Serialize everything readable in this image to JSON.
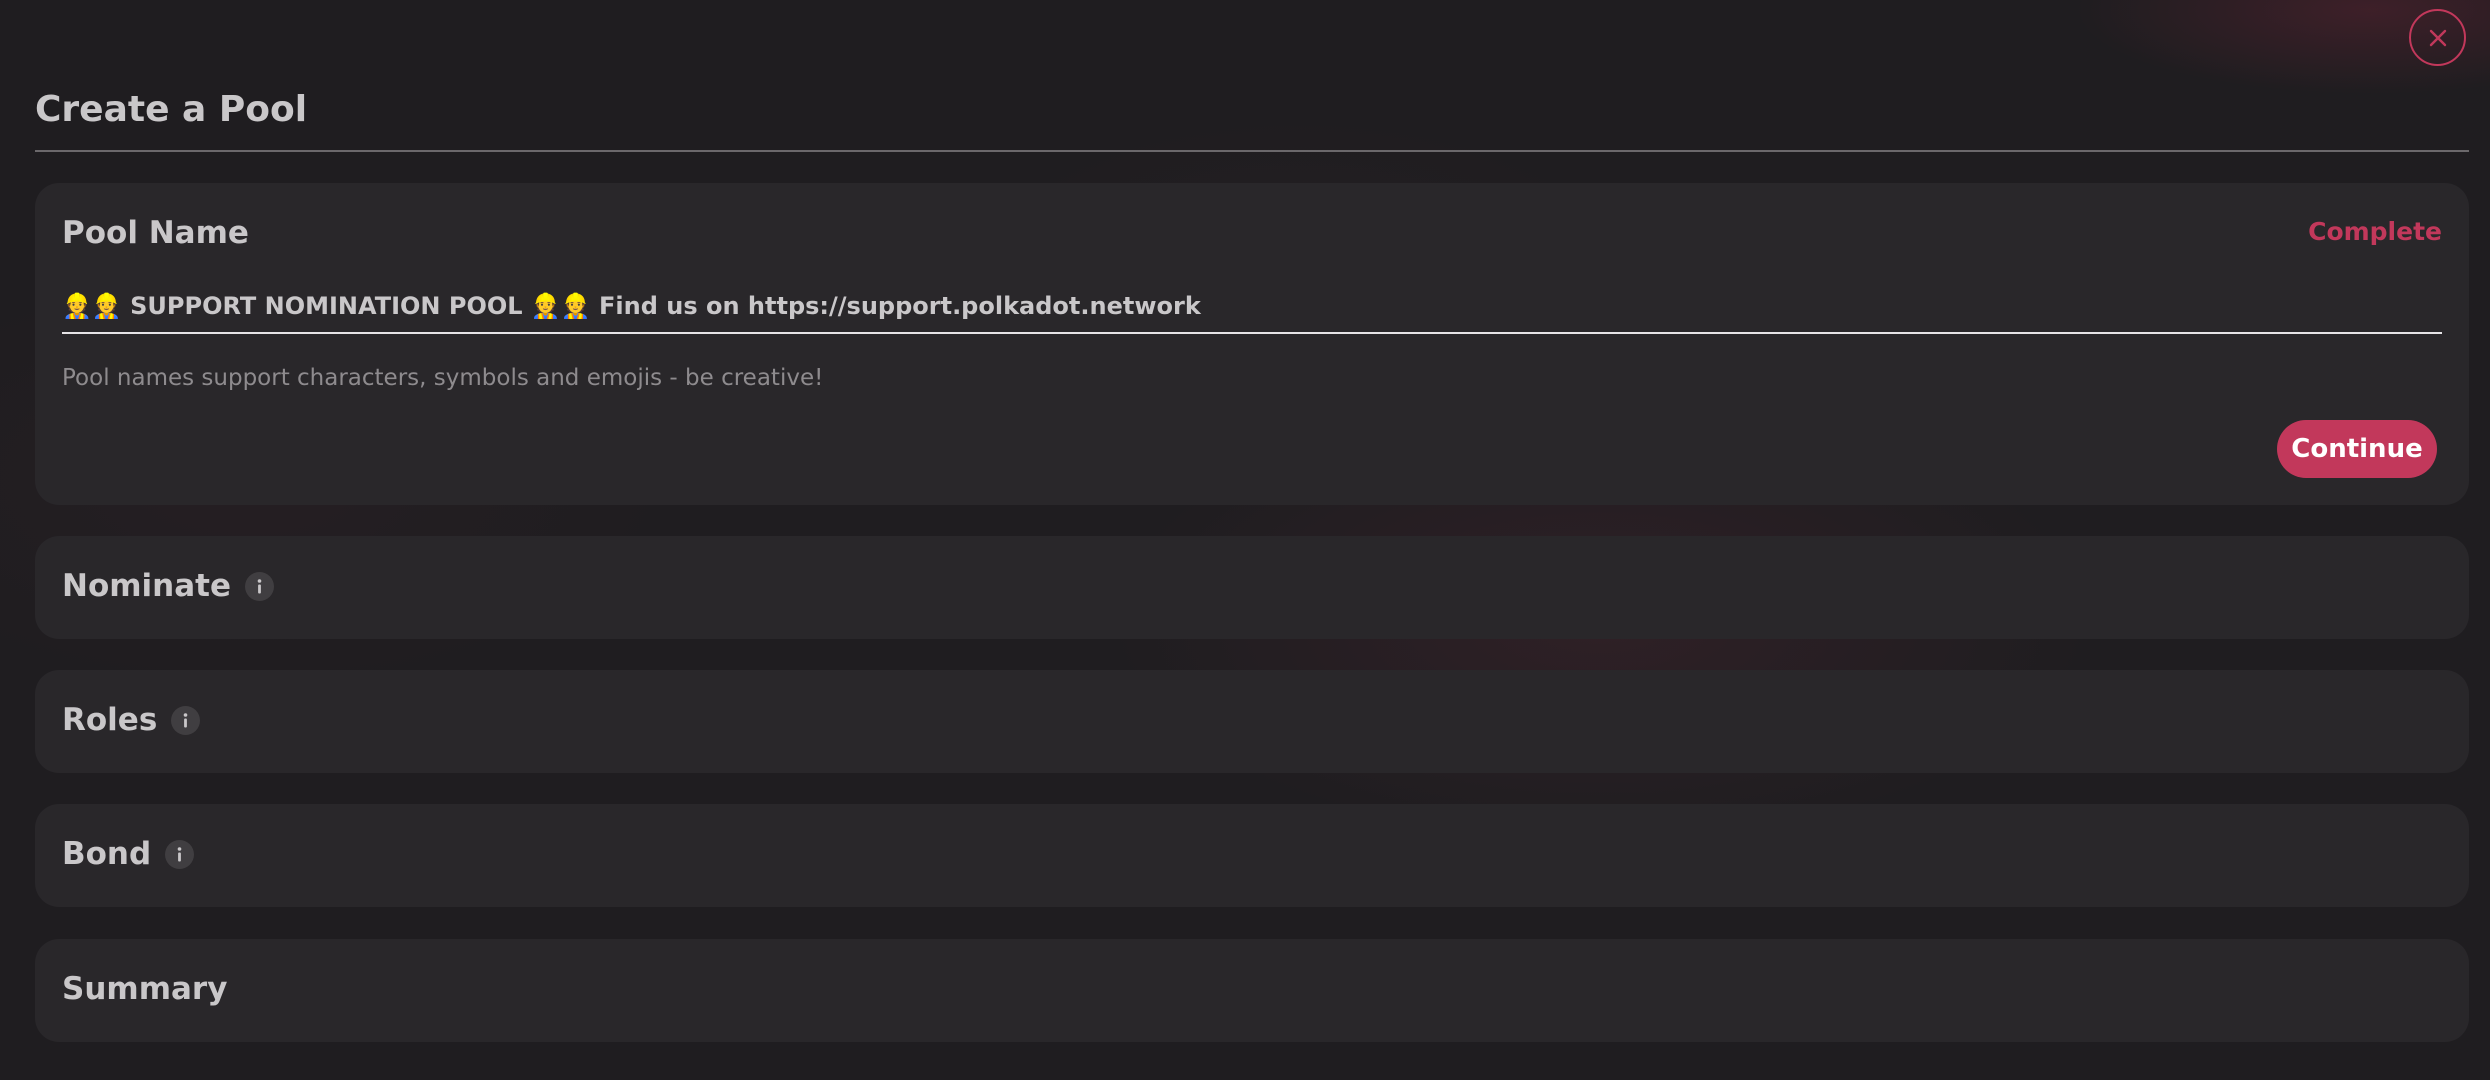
{
  "page": {
    "title": "Create a Pool",
    "close_icon": "close-icon"
  },
  "sections": {
    "pool_name": {
      "title": "Pool Name",
      "status": "Complete",
      "input_value": "👷👷 SUPPORT NOMINATION POOL 👷👷 Find us on https://support.polkadot.network",
      "helper": "Pool names support characters, symbols and emojis - be creative!",
      "continue_label": "Continue"
    },
    "nominate": {
      "title": "Nominate",
      "icon": "info-icon"
    },
    "roles": {
      "title": "Roles",
      "icon": "info-icon"
    },
    "bond": {
      "title": "Bond",
      "icon": "info-icon"
    },
    "summary": {
      "title": "Summary"
    }
  },
  "colors": {
    "background": "#1f1d20",
    "card": "#29272a",
    "accent": "#c2385b",
    "text": "#c9c7c9",
    "muted_text": "#8e8b8e"
  }
}
